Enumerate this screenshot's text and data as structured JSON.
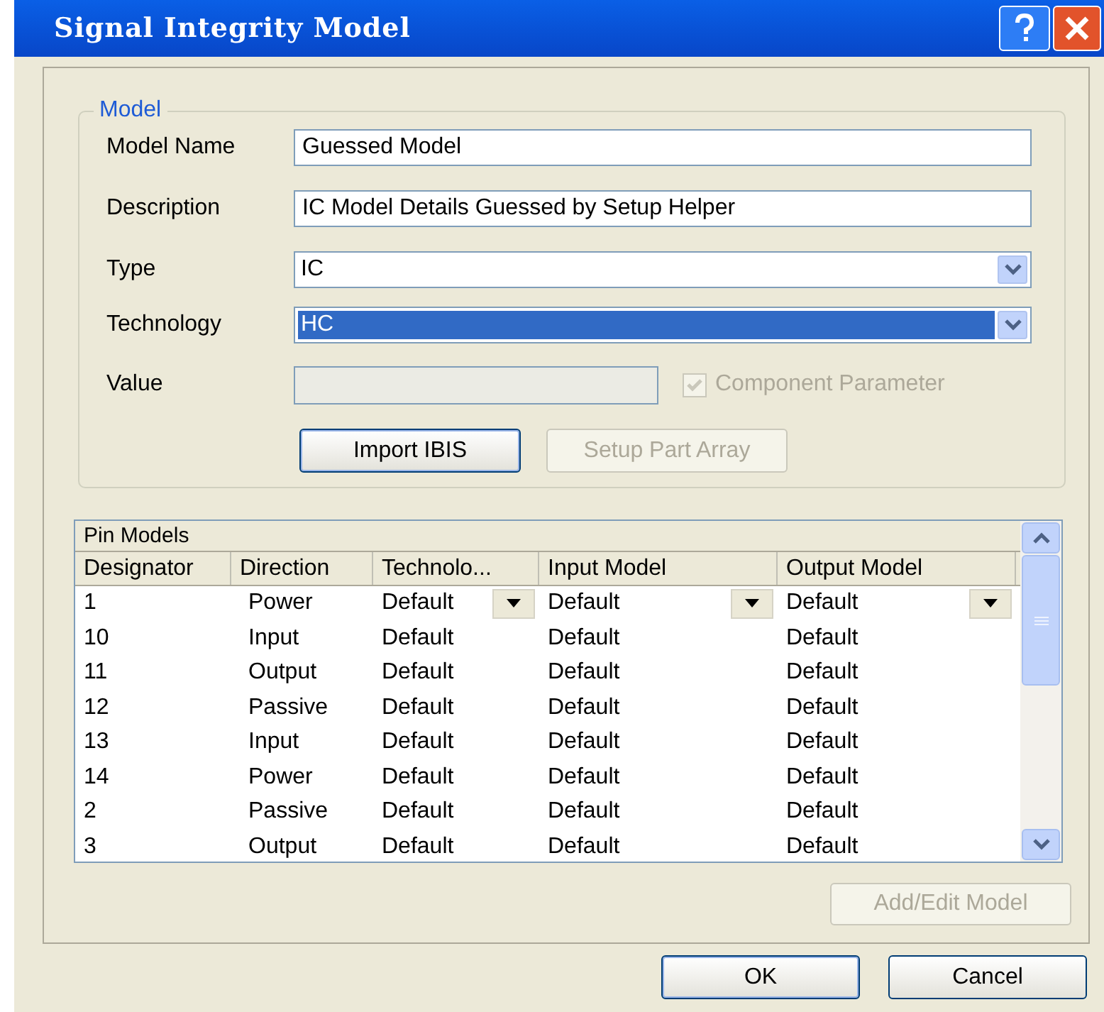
{
  "window": {
    "title": "Signal Integrity Model"
  },
  "model": {
    "legend": "Model",
    "fields": [
      {
        "kind": "text",
        "label": "Model Name",
        "value": "Guessed Model"
      },
      {
        "kind": "text",
        "label": "Description",
        "value": "IC Model Details Guessed by Setup Helper"
      },
      {
        "kind": "combo",
        "label": "Type",
        "value": "IC",
        "focused": false
      },
      {
        "kind": "combo",
        "label": "Technology",
        "value": "HC",
        "focused": true
      },
      {
        "kind": "value",
        "label": "Value",
        "value_disabled": true,
        "checkbox": {
          "label": "Component Parameter",
          "checked": true,
          "disabled": true
        }
      }
    ],
    "buttons": [
      {
        "label": "Import IBIS",
        "disabled": false,
        "default": true
      },
      {
        "label": "Setup Part Array",
        "disabled": true
      }
    ]
  },
  "pin_models": {
    "title": "Pin Models",
    "columns": [
      "Designator",
      "Direction",
      "Technolo...",
      "Input Model",
      "Output Model"
    ],
    "rows": [
      {
        "cells": [
          "1",
          "Power",
          "Default",
          "Default",
          "Default"
        ],
        "editing": true
      },
      {
        "cells": [
          "10",
          "Input",
          "Default",
          "Default",
          "Default"
        ],
        "editing": false
      },
      {
        "cells": [
          "11",
          "Output",
          "Default",
          "Default",
          "Default"
        ],
        "editing": false
      },
      {
        "cells": [
          "12",
          "Passive",
          "Default",
          "Default",
          "Default"
        ],
        "editing": false
      },
      {
        "cells": [
          "13",
          "Input",
          "Default",
          "Default",
          "Default"
        ],
        "editing": false
      },
      {
        "cells": [
          "14",
          "Power",
          "Default",
          "Default",
          "Default"
        ],
        "editing": false
      },
      {
        "cells": [
          "2",
          "Passive",
          "Default",
          "Default",
          "Default"
        ],
        "editing": false
      },
      {
        "cells": [
          "3",
          "Output",
          "Default",
          "Default",
          "Default"
        ],
        "editing": false
      }
    ],
    "button": {
      "label": "Add/Edit Model",
      "disabled": true
    }
  },
  "buttons": [
    {
      "label": "OK",
      "default": true
    },
    {
      "label": "Cancel",
      "default": false
    }
  ]
}
